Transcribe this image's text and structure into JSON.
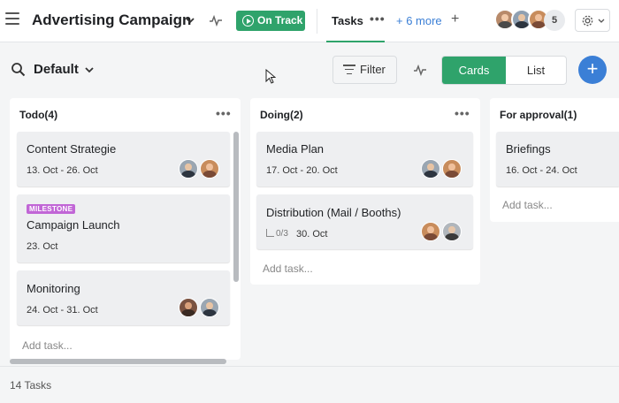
{
  "header": {
    "project_title": "Advertising Campaign",
    "status_label": "On Track",
    "active_tab": "Tasks",
    "more_tabs": "+ 6 more",
    "add_tab": "+",
    "member_count": "5",
    "colors": {
      "accent_green": "#2fa36b",
      "link_blue": "#3b7fd6"
    }
  },
  "toolbar": {
    "view_name": "Default",
    "filter_label": "Filter",
    "view_toggle": {
      "cards": "Cards",
      "list": "List",
      "selected": "Cards"
    },
    "add_button": "+"
  },
  "columns": [
    {
      "title": "Todo(4)",
      "cards": [
        {
          "title": "Content Strategie",
          "dates": "13. Oct - 26. Oct"
        },
        {
          "badge": "MILESTONE",
          "title": "Campaign Launch",
          "dates": "23. Oct"
        },
        {
          "title": "Monitoring",
          "dates": "24. Oct - 31. Oct"
        }
      ],
      "add_task": "Add task..."
    },
    {
      "title": "Doing(2)",
      "cards": [
        {
          "title": "Media Plan",
          "dates": "17. Oct - 20. Oct"
        },
        {
          "title": "Distribution (Mail / Booths)",
          "subtasks": "0/3",
          "dates": "30. Oct"
        }
      ],
      "add_task": "Add task..."
    },
    {
      "title": "For approval(1)",
      "cards": [
        {
          "title": "Briefings",
          "dates": "16. Oct - 24. Oct"
        }
      ],
      "add_task": "Add task..."
    }
  ],
  "footer": {
    "task_count": "14 Tasks"
  }
}
